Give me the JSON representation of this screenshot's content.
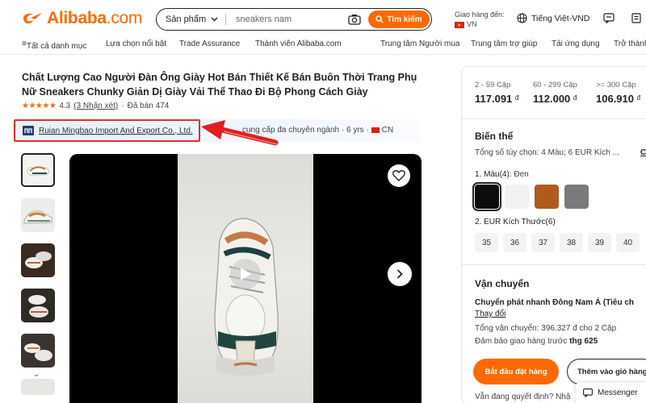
{
  "header": {
    "logo_text": "Alibaba",
    "logo_suffix": ".com",
    "search": {
      "category": "Sản phẩm",
      "query": "sneakers nam",
      "button": "Tìm kiếm"
    },
    "ship_label": "Giao hàng đến:",
    "ship_country": "VN",
    "language": "Tiếng Việt-VND"
  },
  "nav": {
    "all_categories": "Tất cả danh mục",
    "items": [
      "Lựa chọn nổi bật",
      "Trade Assurance",
      "Thành viên Alibaba.com"
    ],
    "right_items": [
      "Trung tâm Người mua",
      "Trung tâm trợ giúp",
      "Tải ứng dụng",
      "Trở thành"
    ]
  },
  "product": {
    "title": "Chất Lượng Cao Người Đàn Ông Giày Hot Bán Thiết Kế Bán Buôn Thời Trang Phụ Nữ Sneakers Chunky Giản Dị Giày Vải Thể Thao Đi Bộ Phong Cách Giày",
    "stars": "★★★★★",
    "rating": "4.3",
    "reviews": "(3 Nhận xét)",
    "sold": "Đã bán 474",
    "supplier_name": "Ruian Mingbao Import And Export Co., Ltd.",
    "supplier_info": "cung cấp đa chuyên ngành · 6 yrs ·",
    "supplier_country": "CN"
  },
  "pricing": {
    "tiers": [
      {
        "qty": "2 - 59 Cặp",
        "price": "117.091",
        "unit": "đ"
      },
      {
        "qty": "60 - 299 Cặp",
        "price": "112.000",
        "unit": "đ"
      },
      {
        "qty": ">= 300 Cặp",
        "price": "106.910",
        "unit": "đ"
      }
    ]
  },
  "variants": {
    "title": "Biến thể",
    "summary": "Tổng số tùy chọn: 4 Màu; 6 EUR Kích ...",
    "summary_more": "C",
    "color_label": "1. Màu(4):",
    "color_selected": "Đen",
    "colors": [
      "#0c0c0c",
      "#f1f1f1",
      "#b05a1e",
      "#7a7a7a"
    ],
    "size_label": "2. EUR Kích Thước(6)",
    "sizes": [
      "35",
      "36",
      "37",
      "38",
      "39",
      "40"
    ]
  },
  "shipping": {
    "title": "Vận chuyển",
    "method": "Chuyển phát nhanh Đông Nam Á (Tiêu ch",
    "change": "Thay đổi",
    "cost": "Tổng vận chuyển: 396.327 đ cho 2 Cặp",
    "guarantee_prefix": "Đảm bảo giao hàng trước",
    "guarantee_date": "thg 625"
  },
  "actions": {
    "order": "Bắt đầu đặt hàng",
    "cart": "Thêm vào giỏ hàng",
    "undecided": "Vẫn đang quyết định? Nhậ",
    "messenger": "Messenger"
  }
}
